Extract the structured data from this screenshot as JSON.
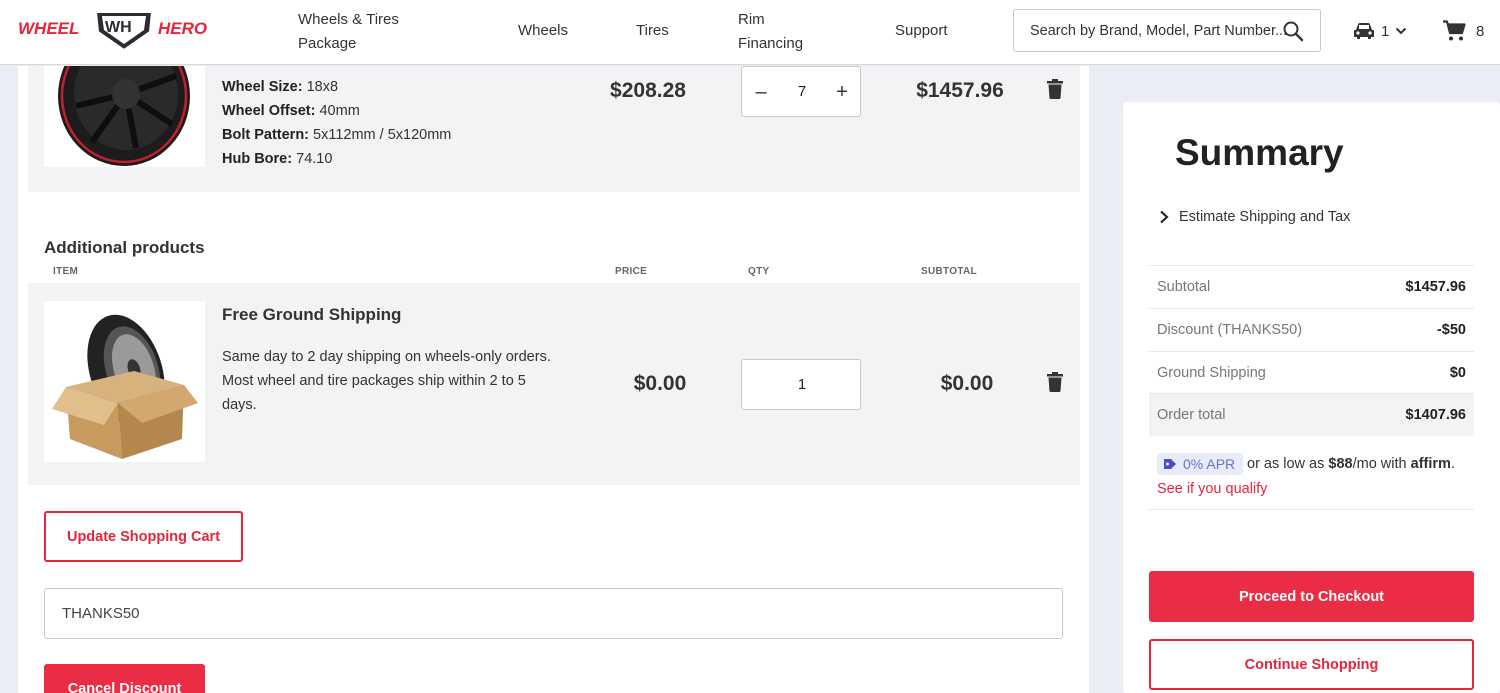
{
  "header": {
    "logo_text": "WHEEL WH HERO",
    "nav": [
      {
        "label_line1": "Wheels & Tires",
        "label_line2": "Package"
      },
      {
        "label": "Wheels"
      },
      {
        "label": "Tires"
      },
      {
        "label_line1": "Rim",
        "label_line2": "Financing"
      },
      {
        "label": "Support"
      }
    ],
    "search_placeholder": "Search by Brand, Model, Part Number...",
    "vehicle_count": "1",
    "cart_count": "8"
  },
  "cart_item": {
    "specs": [
      {
        "label": "Wheel Size:",
        "value": "18x8"
      },
      {
        "label": "Wheel Offset:",
        "value": "40mm"
      },
      {
        "label": "Bolt Pattern:",
        "value": "5x112mm / 5x120mm"
      },
      {
        "label": "Hub Bore:",
        "value": "74.10"
      }
    ],
    "price": "$208.28",
    "qty": "7",
    "subtotal": "$1457.96"
  },
  "additional": {
    "title": "Additional products",
    "columns": {
      "item": "ITEM",
      "price": "PRICE",
      "qty": "QTY",
      "subtotal": "SUBTOTAL"
    },
    "product": {
      "name": "Free Ground Shipping",
      "description_lines": [
        "Same day to 2 day shipping on wheels-only orders.",
        "Most wheel and tire packages ship within 2 to 5",
        "days."
      ],
      "price": "$0.00",
      "qty": "1",
      "subtotal": "$0.00"
    }
  },
  "actions": {
    "update_cart": "Update Shopping Cart",
    "coupon_value": "THANKS50",
    "cancel_discount": "Cancel Discount"
  },
  "summary": {
    "title": "Summary",
    "estimate": "Estimate Shipping and Tax",
    "rows": [
      {
        "label": "Subtotal",
        "value": "$1457.96"
      },
      {
        "label": "Discount (THANKS50)",
        "value": "-$50"
      },
      {
        "label": "Ground Shipping",
        "value": "$0"
      },
      {
        "label": "Order total",
        "value": "$1407.96"
      }
    ],
    "affirm": {
      "apr": "0% APR",
      "text_before": "or as low as ",
      "amount": "$88",
      "text_after": "/mo with ",
      "brand": "affirm",
      "period": ".",
      "link": "See if you qualify"
    },
    "checkout": "Proceed to Checkout",
    "continue": "Continue Shopping"
  },
  "colors": {
    "accent": "#ea2c45",
    "page_bg": "#ebedf5",
    "row_bg": "#f3f3f6"
  }
}
